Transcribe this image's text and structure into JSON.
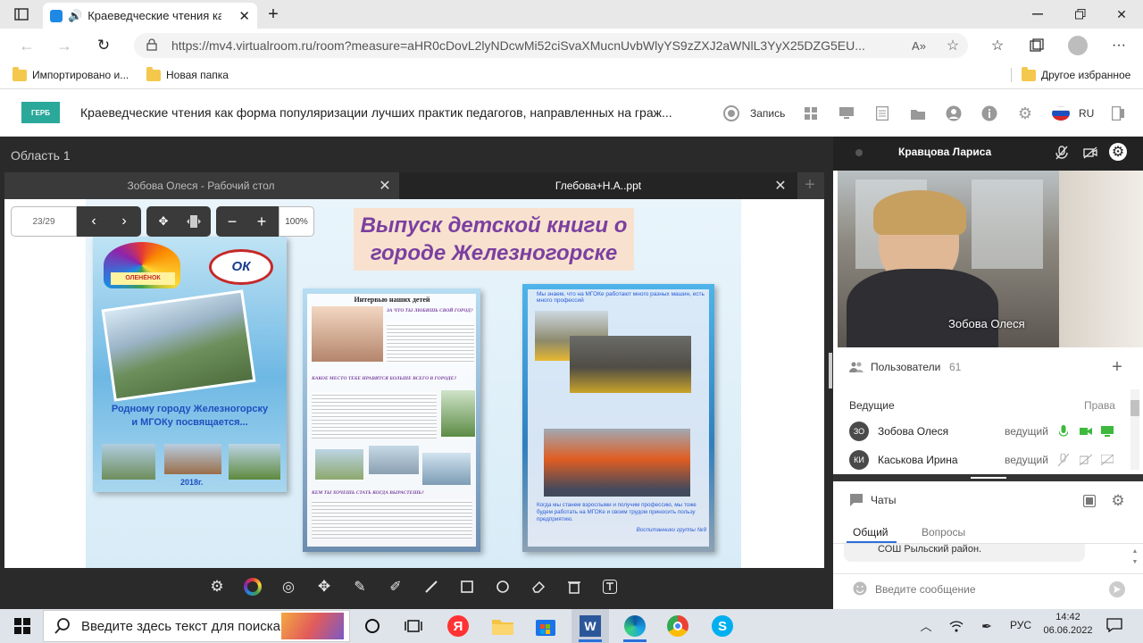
{
  "browser": {
    "tab_title": "Краеведческие чтения как форма п",
    "url": "https://mv4.virtualroom.ru/room?measure=aHR0cDovL2lyNDcwMi52ciSvaXMucnUvbWlyYS9zZXJ2aWNlL3YyX25DZG5EU...",
    "bookmarks": [
      "Импортировано и...",
      "Новая папка"
    ],
    "bookmark_right": "Другое избранное"
  },
  "app": {
    "logo_text": "ГЕРБ",
    "title": "Краеведческие чтения как форма популяризации лучших практик педагогов, направленных на граж...",
    "record_label": "Запись",
    "lang": "RU"
  },
  "workspace": {
    "area_label": "Область 1",
    "tabs": [
      "Зобова Олеся - Рабочий стол",
      "Глебова+Н.А..ppt"
    ],
    "page_counter": "23/29",
    "zoom": "100%"
  },
  "slide": {
    "title_line1": "Выпуск детской книги о",
    "title_line2": "городе Железногорске",
    "left_caption_line1": "Родному городу Железногорску",
    "left_caption_line2": "и МГОКу посвящается...",
    "left_year": "2018г.",
    "left_badge": "ОЛЕНЁНОК",
    "left_logo": "ОК",
    "mid_title": "Интервью наших детей",
    "mid_q1": "ЗА ЧТО ТЫ ЛЮБИШЬ СВОЙ ГОРОД?",
    "mid_q2": "КАКОЕ МЕСТО ТЕБЕ НРАВИТСЯ БОЛЬШЕ ВСЕГО В ГОРОДЕ?",
    "mid_q3": "КЕМ ТЫ ХОЧЕШЬ СТАТЬ КОГДА ВЫРАСТЕШЬ?",
    "right_top_text": "Мы знаем, что на МГОКе работают много разных машин, есть много профессий",
    "right_bottom_text": "Когда мы станем взрослыми и получим профессию, мы тоже будем работать на МГОКе и своим трудом приносить пользу предприятию.",
    "right_sign": "Воспитанники группы №9"
  },
  "video": {
    "presenter": "Кравцова Лариса",
    "caption": "Зобова Олеся"
  },
  "users": {
    "label": "Пользователи",
    "count": "61",
    "section": "Ведущие",
    "rights": "Права",
    "list": [
      {
        "initials": "ЗО",
        "name": "Зобова Олеся",
        "role": "ведущий"
      },
      {
        "initials": "КИ",
        "name": "Каськова Ирина",
        "role": "ведущий"
      }
    ]
  },
  "chat": {
    "label": "Чаты",
    "tabs": [
      "Общий",
      "Вопросы"
    ],
    "message": "СОШ Рыльский район.",
    "placeholder": "Введите сообщение"
  },
  "taskbar": {
    "search_placeholder": "Введите здесь текст для поиска",
    "lang": "РУС",
    "time": "14:42",
    "date": "06.06.2022"
  },
  "colors": {
    "accent": "#7b3fa0",
    "dark_bg": "#2a2a2a",
    "active_tab_line": "#2a6fdb"
  }
}
